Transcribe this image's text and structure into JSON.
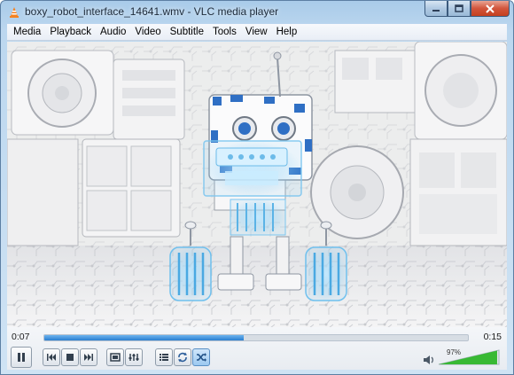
{
  "window": {
    "title": "boxy_robot_interface_14641.wmv - VLC media player"
  },
  "menu": [
    "Media",
    "Playback",
    "Audio",
    "Video",
    "Subtitle",
    "Tools",
    "View",
    "Help"
  ],
  "playback": {
    "elapsed": "0:07",
    "total": "0:15",
    "progress": 0.47
  },
  "volume": {
    "label": "97%",
    "level": 0.97
  },
  "colors": {
    "accent": "#2a7fd1",
    "volume_green": "#38b934",
    "close_red": "#c4401f"
  },
  "icons": {
    "app": "vlc-cone-icon",
    "play_pause": "pause-icon",
    "previous": "previous-icon",
    "stop": "stop-icon",
    "next": "next-icon",
    "fullscreen": "fullscreen-icon",
    "extended": "extended-settings-icon",
    "playlist": "playlist-icon",
    "loop": "loop-icon",
    "random": "shuffle-icon",
    "volume": "speaker-icon"
  }
}
